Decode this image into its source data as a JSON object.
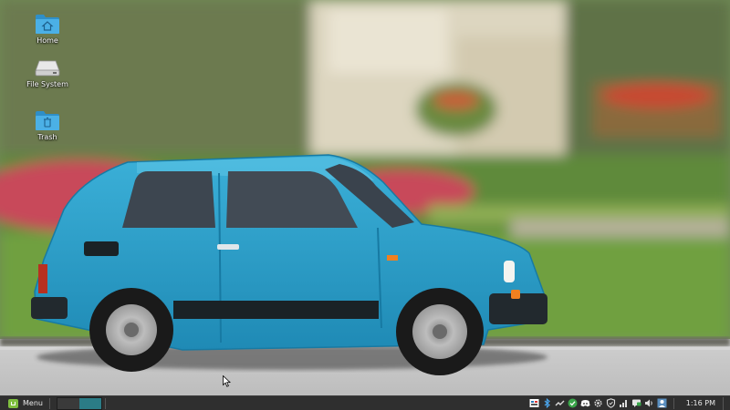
{
  "desktop": {
    "icons": [
      {
        "label": "Home",
        "icon": "home-folder-icon"
      },
      {
        "label": "File System",
        "icon": "drive-icon"
      },
      {
        "label": "Trash",
        "icon": "trash-folder-icon"
      }
    ]
  },
  "panel": {
    "menu_label": "Menu",
    "workspaces": 2,
    "active_workspace": 2,
    "tray": [
      "keyboard-layout-icon",
      "bluetooth-icon",
      "network-tool-icon",
      "checkmark-icon",
      "discord-icon",
      "gear-icon",
      "shield-icon",
      "signal-bars-icon",
      "chat-icon",
      "volume-icon",
      "user-icon"
    ],
    "clock": "1:16 PM"
  },
  "colors": {
    "panel_bg": "#2f2f2f",
    "folder_blue": "#3aa0d8",
    "car_blue": "#2a9fca",
    "mint_green": "#7fbf3f",
    "workspace_active": "#2b7c86"
  }
}
